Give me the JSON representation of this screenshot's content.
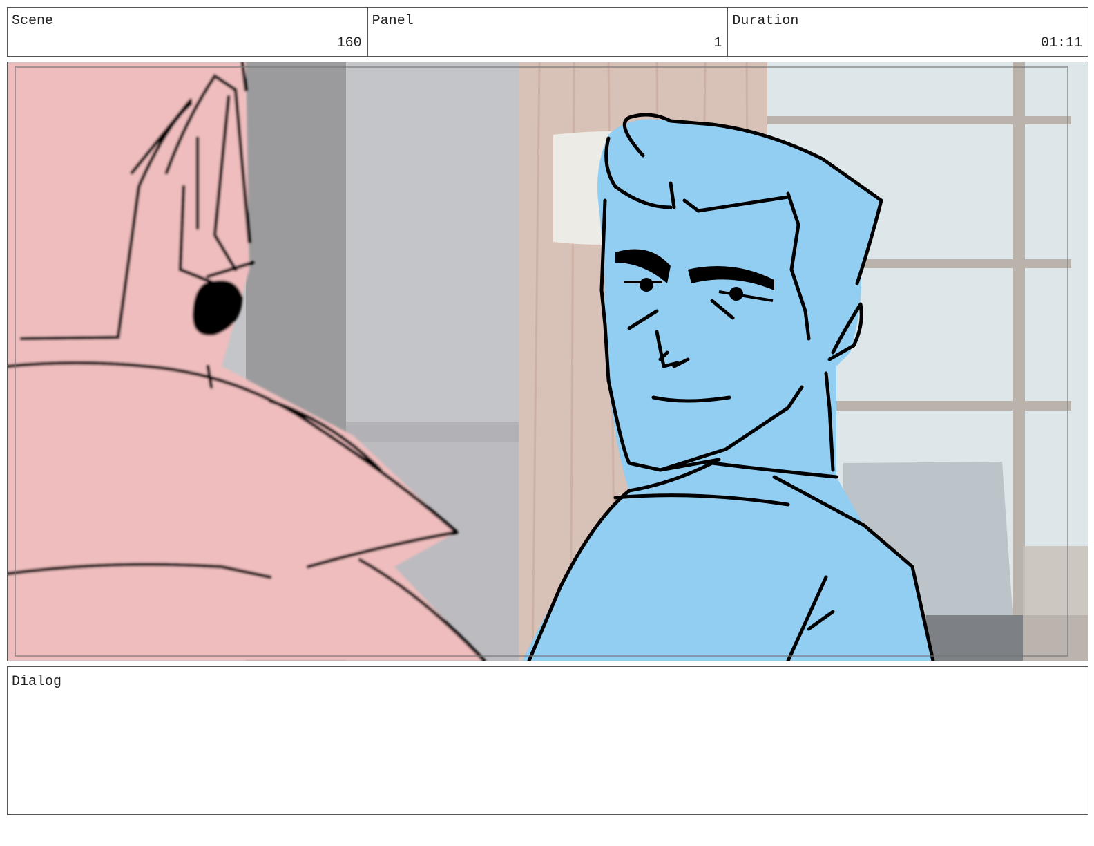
{
  "header": {
    "scene": {
      "label": "Scene",
      "value": "160"
    },
    "panel": {
      "label": "Panel",
      "value": "1"
    },
    "duration": {
      "label": "Duration",
      "value": "01:11"
    }
  },
  "dialog": {
    "label": "Dialog",
    "text": ""
  },
  "colors": {
    "foreground_character": "#efbdbd",
    "main_character": "#92cdf2",
    "ink": "#000000",
    "curtain": "#d9bdb1",
    "wall": "#c4c5c8",
    "window": "#dde6e8"
  }
}
